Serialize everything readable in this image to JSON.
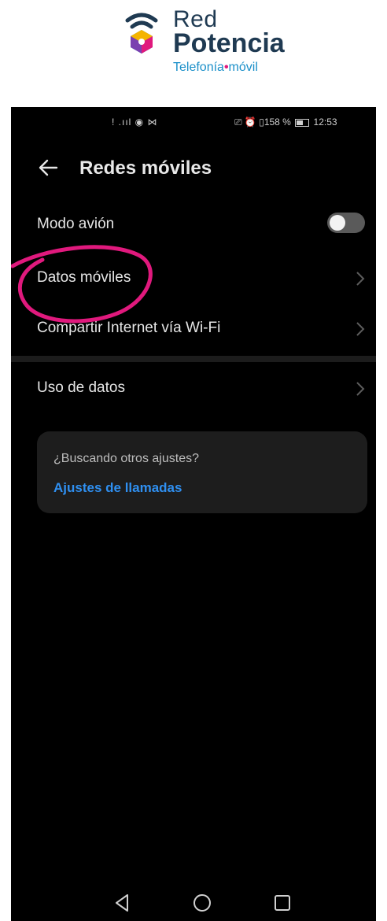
{
  "brand": {
    "name_line1": "Red",
    "name_line2": "Potencia",
    "tagline_part1": "Telefonía",
    "tagline_dot": "•",
    "tagline_part2": "móvil"
  },
  "status_bar": {
    "left_icons": "ǃ .ııl ◉ ⋈",
    "right_text": "⎚ ⏰ ▯158 %",
    "time": "12:53",
    "battery_percent": 58
  },
  "app_bar": {
    "title": "Redes móviles"
  },
  "settings": {
    "items": [
      {
        "label": "Modo avión",
        "type": "toggle",
        "checked": false
      },
      {
        "label": "Datos móviles",
        "type": "link"
      },
      {
        "label": "Compartir Internet vía Wi-Fi",
        "type": "link"
      },
      {
        "label": "Uso de datos",
        "type": "link"
      }
    ]
  },
  "suggestion_card": {
    "question": "¿Buscando otros ajustes?",
    "link": "Ajustes de llamadas"
  },
  "colors": {
    "background": "#000000",
    "accent_link": "#2f8ff0",
    "highlight_circle": "#e0197d",
    "brand_dark": "#1f3a52",
    "brand_blue": "#1a8fc9"
  },
  "icons": {
    "back": "arrow-left-icon",
    "chevron": "chevron-right-icon",
    "nav_back": "triangle-back-icon",
    "nav_home": "circle-home-icon",
    "nav_recents": "square-recents-icon"
  }
}
